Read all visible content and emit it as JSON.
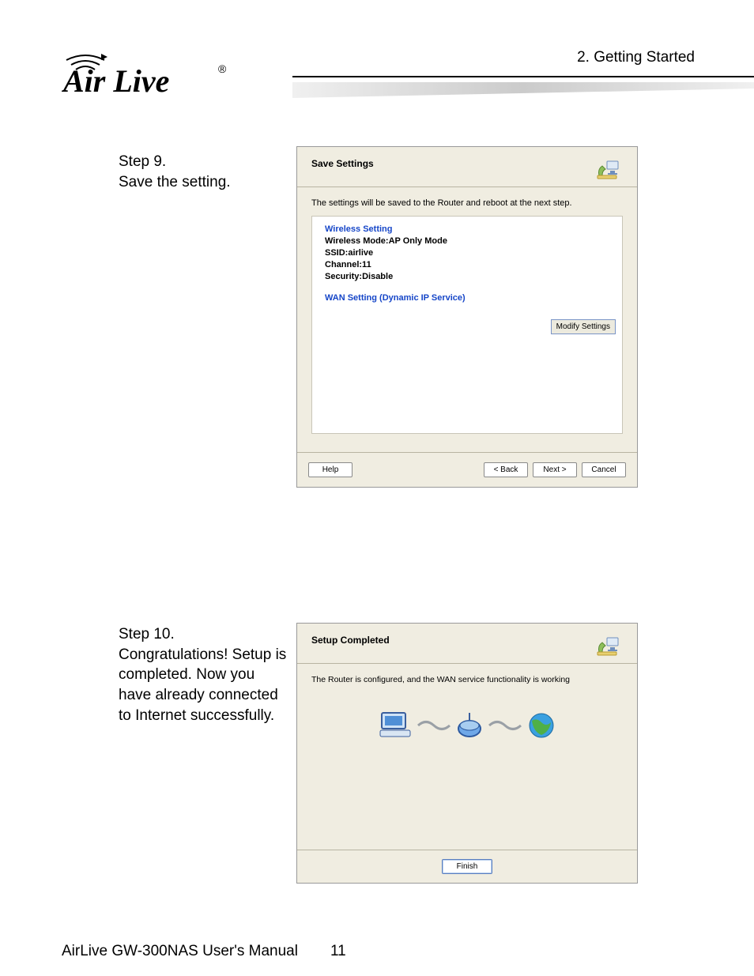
{
  "header": {
    "chapter": "2. Getting Started"
  },
  "logo": {
    "brand": "Air Live",
    "registered": "®"
  },
  "step9": {
    "title": "Step 9.",
    "desc": "Save the setting."
  },
  "step10": {
    "title": "Step 10.",
    "desc": "Congratulations! Setup is completed. Now you have already connected to Internet successfully."
  },
  "dlg1": {
    "title": "Save Settings",
    "intro": "The settings will be saved to the Router and reboot at the next step.",
    "wireless_header": "Wireless Setting",
    "wireless_mode": "Wireless Mode:AP Only Mode",
    "ssid": "SSID:airlive",
    "channel": "Channel:11",
    "security": "Security:Disable",
    "wan_header": "WAN Setting  (Dynamic IP Service)",
    "modify": "Modify Settings",
    "help": "Help",
    "back": "< Back",
    "next": "Next >",
    "cancel": "Cancel"
  },
  "dlg2": {
    "title": "Setup Completed",
    "msg": "The Router is configured, and the WAN service functionality is working",
    "finish": "Finish"
  },
  "footer": {
    "manual": "AirLive GW-300NAS User's Manual",
    "page": "11"
  }
}
